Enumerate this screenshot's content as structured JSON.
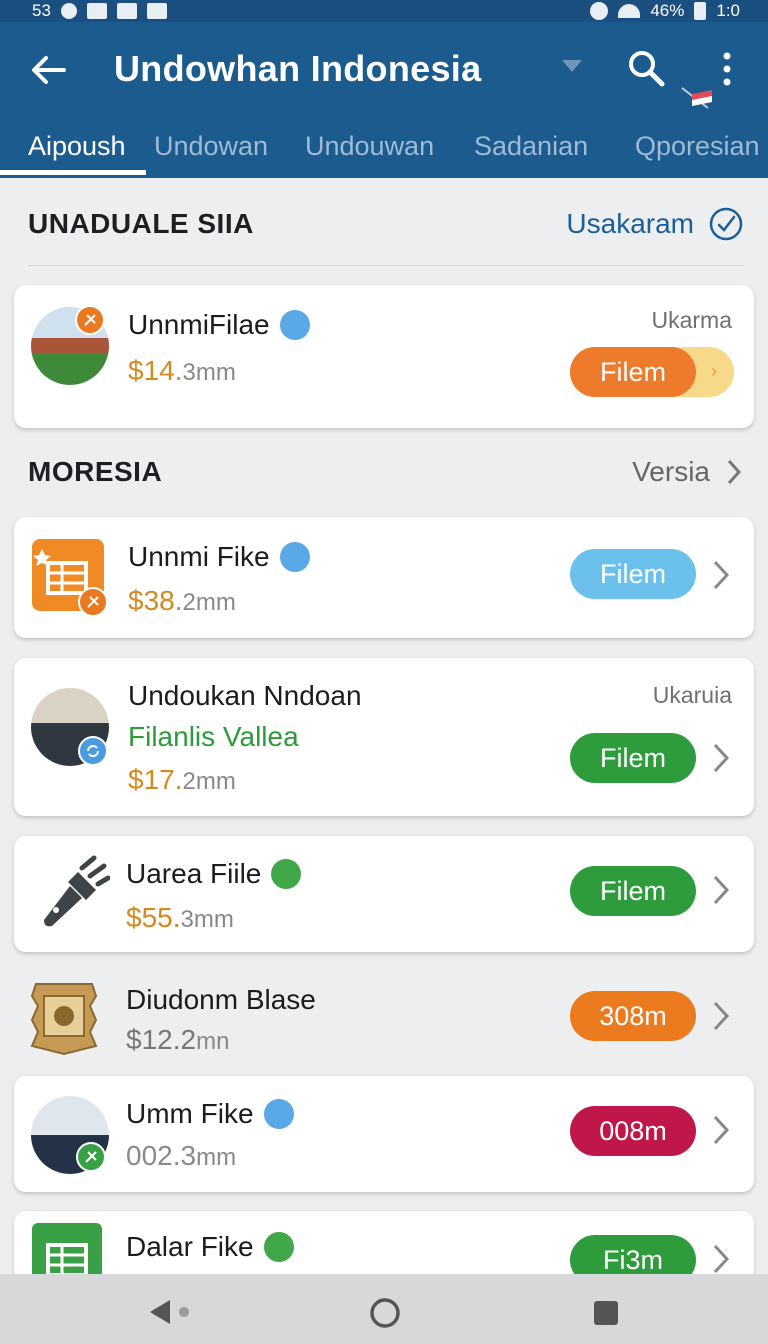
{
  "status_bar": {
    "left_text": "53",
    "battery": "46%",
    "time": "1:0"
  },
  "app_bar": {
    "title": "Undowhan Indonesia",
    "title_dots": "··"
  },
  "tabs": [
    {
      "label": "Aipoush",
      "active": true
    },
    {
      "label": "Undowan"
    },
    {
      "label": "Undouwan"
    },
    {
      "label": "Sadanian"
    },
    {
      "label": "Qporesian"
    }
  ],
  "section1": {
    "title": "UNADUALE SIIA",
    "link": "Usakaram"
  },
  "section2": {
    "title": "MORESIA",
    "link": "Versia"
  },
  "items": [
    {
      "name": "UnnmiFilae",
      "price_num": "$14.",
      "price_dec": "3",
      "price_unit": "mm",
      "right_label": "Ukarma",
      "button": "Filem",
      "button_color": "#ee7a2b"
    },
    {
      "name": "Unnmi Fike",
      "price_num": "$38.",
      "price_dec": "2",
      "price_unit": "mm",
      "button": "Filem",
      "button_color": "#6cc0ec"
    },
    {
      "name": "Undoukan Nndoan",
      "subtitle": "Filanlis Vallea",
      "price_num": "$17.",
      "price_dec": "2",
      "price_unit": "mm",
      "right_label": "Ukaruia",
      "button": "Filem",
      "button_color": "#2e9c3c"
    },
    {
      "name": "Uarea Fiile",
      "price_num": "$55.",
      "price_dec": "3",
      "price_unit": "mm",
      "button": "Filem",
      "button_color": "#2e9c3c"
    },
    {
      "name": "Diudonm Blase",
      "price_num": "$12.2",
      "price_dec": "",
      "price_unit": "mn",
      "button": "308m",
      "button_color": "#ec7b1f"
    },
    {
      "name": "Umm Fike",
      "price_num": "002.3",
      "price_dec": "",
      "price_unit": "mm",
      "button": "008m",
      "button_color": "#c0174a"
    },
    {
      "name": "Dalar Fike",
      "button": "Fi3m",
      "button_color": "#2e9c3c"
    }
  ],
  "colors": {
    "appbar": "#1c5b8d",
    "accent_blue": "#1b5f96",
    "price": "#d38a1f"
  }
}
